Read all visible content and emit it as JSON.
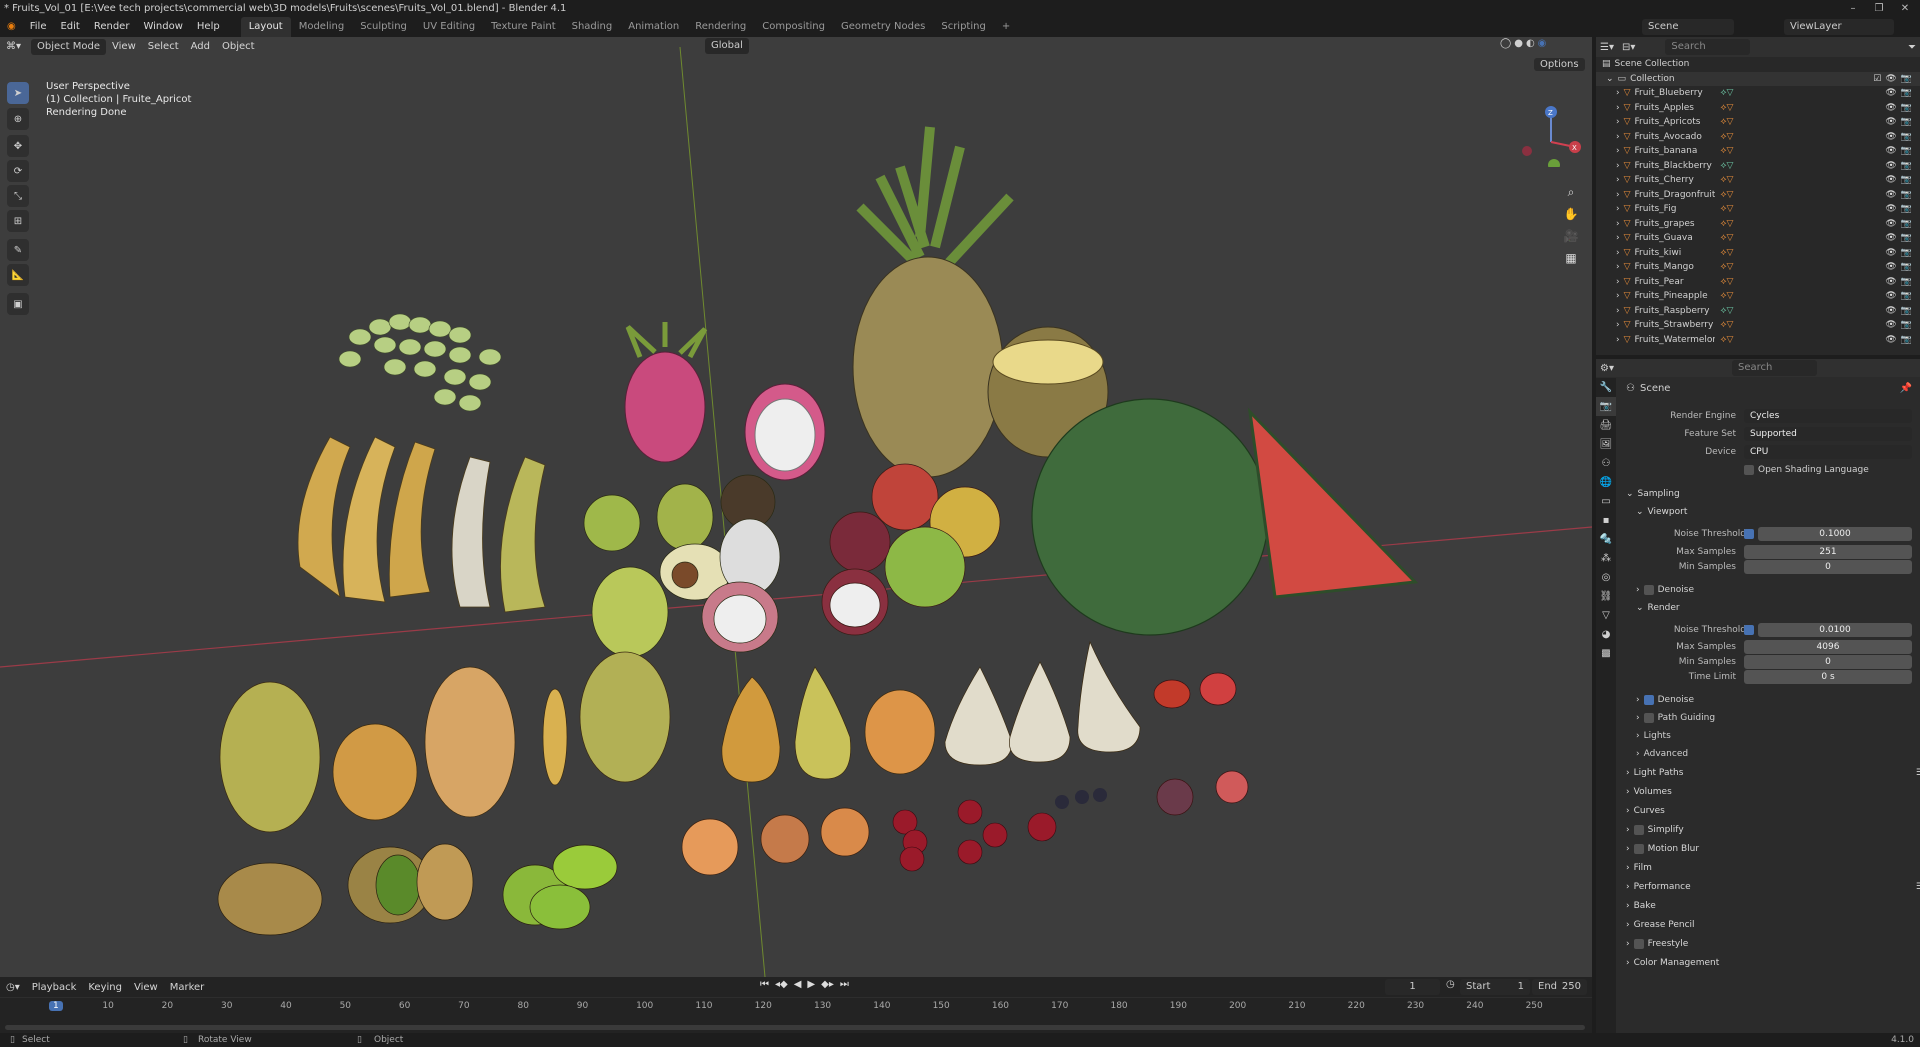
{
  "window": {
    "title": "* Fruits_Vol_01 [E:\\Vee tech projects\\commercial web\\3D models\\Fruits\\scenes\\Fruits_Vol_01.blend] - Blender 4.1"
  },
  "menus": [
    "File",
    "Edit",
    "Render",
    "Window",
    "Help"
  ],
  "workspaces": [
    "Layout",
    "Modeling",
    "Sculpting",
    "UV Editing",
    "Texture Paint",
    "Shading",
    "Animation",
    "Rendering",
    "Compositing",
    "Geometry Nodes",
    "Scripting"
  ],
  "workspace_add": "+",
  "scene_field": "Scene",
  "viewlayer_field": "ViewLayer",
  "viewport": {
    "mode": "Object Mode",
    "menus": [
      "View",
      "Select",
      "Add",
      "Object"
    ],
    "orientation": "Global",
    "options": "Options",
    "info_line1": "User Perspective",
    "info_line2": "(1) Collection | Fruite_Apricot",
    "info_line3": "Rendering Done",
    "gizmo_z": "Z",
    "gizmo_y": "Y",
    "gizmo_x": "X"
  },
  "outliner": {
    "search_placeholder": "Search",
    "root": "Scene Collection",
    "collection": "Collection",
    "items": [
      "Fruit_Blueberry",
      "Fruits_Apples",
      "Fruits_Apricots",
      "Fruits_Avocado",
      "Fruits_banana",
      "Fruits_Blackberry",
      "Fruits_Cherry",
      "Fruits_Dragonfruits",
      "Fruits_Fig",
      "Fruits_grapes",
      "Fruits_Guava",
      "Fruits_kiwi",
      "Fruits_Mango",
      "Fruits_Pear",
      "Fruits_Pineapple",
      "Fruits_Raspberry",
      "Fruits_Strawberry",
      "Fruits_Watermelon"
    ]
  },
  "properties": {
    "search_placeholder": "Search",
    "context": "Scene",
    "render_engine_label": "Render Engine",
    "render_engine": "Cycles",
    "feature_set_label": "Feature Set",
    "feature_set": "Supported",
    "device_label": "Device",
    "device": "CPU",
    "osl": "Open Shading Language",
    "sampling": "Sampling",
    "viewport": "Viewport",
    "noise_threshold_label": "Noise Threshold",
    "vp_noise_threshold": "0.1000",
    "max_samples_label": "Max Samples",
    "vp_max_samples": "251",
    "min_samples_label": "Min Samples",
    "vp_min_samples": "0",
    "denoise": "Denoise",
    "render": "Render",
    "r_noise_threshold": "0.0100",
    "r_max_samples": "4096",
    "r_min_samples": "0",
    "time_limit_label": "Time Limit",
    "r_time_limit": "0 s",
    "path_guiding": "Path Guiding",
    "lights": "Lights",
    "advanced": "Advanced",
    "sections": [
      "Light Paths",
      "Volumes",
      "Curves",
      "Simplify",
      "Motion Blur",
      "Film",
      "Performance",
      "Bake",
      "Grease Pencil",
      "Freestyle",
      "Color Management"
    ]
  },
  "timeline": {
    "menus": [
      "Playback",
      "Keying",
      "View",
      "Marker"
    ],
    "current_frame": "1",
    "start_label": "Start",
    "start": "1",
    "end_label": "End",
    "end": "250",
    "ticks": [
      "1",
      "10",
      "20",
      "30",
      "40",
      "50",
      "60",
      "70",
      "80",
      "90",
      "100",
      "110",
      "120",
      "130",
      "140",
      "150",
      "160",
      "170",
      "180",
      "190",
      "200",
      "210",
      "220",
      "230",
      "240",
      "250"
    ]
  },
  "status": {
    "select": "Select",
    "rotate": "Rotate View",
    "object": "Object",
    "version": "4.1.0"
  },
  "colors": {
    "accent": "#4772b3",
    "viewport_bg": "#3d3d3d",
    "x_axis": "#b54a55",
    "y_axis": "#7e9a3a"
  }
}
